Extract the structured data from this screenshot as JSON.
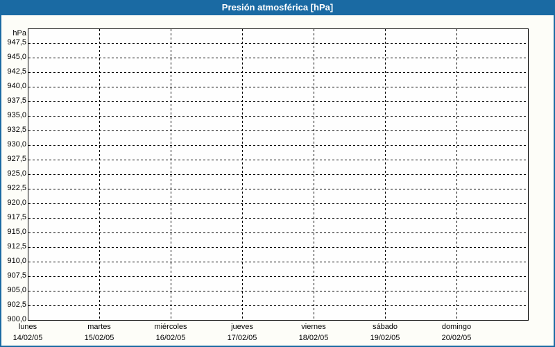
{
  "window": {
    "title": "Presión atmosférica [hPa]"
  },
  "colors": {
    "titlebar_bg": "#1a6aa3",
    "titlebar_text": "#ffffff",
    "frame_border": "#1a6aa3",
    "content_bg": "#fdfdf8",
    "plot_bg": "#fefefe",
    "grid": "#000000",
    "label_text": "#000000"
  },
  "chart_data": {
    "type": "line",
    "title": "Presión atmosférica [hPa]",
    "y_axis": {
      "unit": "hPa",
      "ylim": [
        900,
        950
      ],
      "tick_step": 2.5,
      "decimal_separator": ",",
      "tick_labels": [
        "947,5",
        "945,0",
        "942,5",
        "940,0",
        "937,5",
        "935,0",
        "932,5",
        "930,0",
        "927,5",
        "925,0",
        "922,5",
        "920,0",
        "917,5",
        "915,0",
        "912,5",
        "910,0",
        "907,5",
        "905,0",
        "902,5",
        "900,0"
      ]
    },
    "x_axis": {
      "days": [
        {
          "name": "lunes",
          "date": "14/02/05"
        },
        {
          "name": "martes",
          "date": "15/02/05"
        },
        {
          "name": "miércoles",
          "date": "16/02/05"
        },
        {
          "name": "jueves",
          "date": "17/02/05"
        },
        {
          "name": "viernes",
          "date": "18/02/05"
        },
        {
          "name": "sábado",
          "date": "19/02/05"
        },
        {
          "name": "domingo",
          "date": "20/02/05"
        }
      ]
    },
    "series": [],
    "grid": {
      "style": "dashed",
      "horizontal_spacing_hpa": 2.5,
      "vertical_per_day": true
    },
    "legend": "none"
  }
}
